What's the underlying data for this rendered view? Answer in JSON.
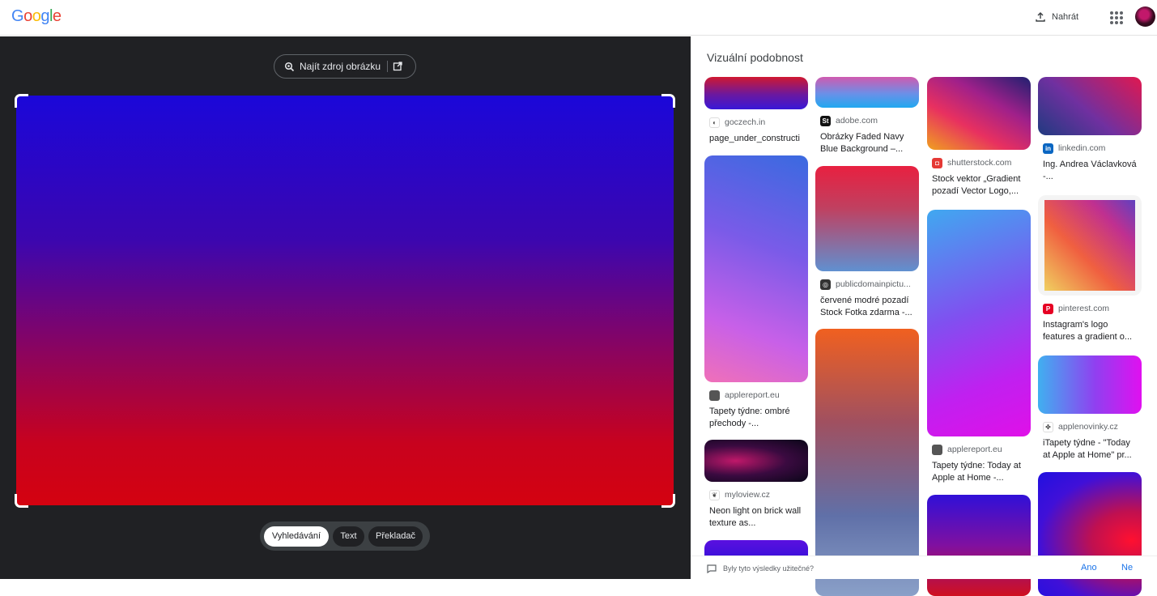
{
  "header": {
    "logo_letters": [
      {
        "ch": "G",
        "color": "#4285f4"
      },
      {
        "ch": "o",
        "color": "#ea4335"
      },
      {
        "ch": "o",
        "color": "#fbbc05"
      },
      {
        "ch": "g",
        "color": "#4285f4"
      },
      {
        "ch": "l",
        "color": "#34a853"
      },
      {
        "ch": "e",
        "color": "#ea4335"
      }
    ],
    "upload_label": "Nahrát"
  },
  "left_pane": {
    "find_source_label": "Najít zdroj obrázku",
    "modes": [
      {
        "label": "Vyhledávání",
        "active": true
      },
      {
        "label": "Text",
        "active": false
      },
      {
        "label": "Překladač",
        "active": false
      }
    ]
  },
  "results": {
    "title": "Vizuální podobnost",
    "columns": [
      [
        {
          "site": "goczech.in",
          "title": "page_under_constructi",
          "favicon": "#ffffff",
          "fav_glyph": "◐"
        },
        {
          "site": "applereport.eu",
          "title": "Tapety týdne: ombré přechody -...",
          "favicon": "#555555",
          "fav_glyph": ""
        },
        {
          "site": "myloview.cz",
          "title": "Neon light on brick wall texture as...",
          "favicon": "#ffffff",
          "fav_glyph": "❦"
        },
        {
          "site": "",
          "title": "",
          "favicon": "#ffffff",
          "fav_glyph": ""
        }
      ],
      [
        {
          "site": "adobe.com",
          "title": "Obrázky Faded Navy Blue Background –...",
          "favicon": "#111111",
          "fav_glyph": "St"
        },
        {
          "site": "publicdomainpictu...",
          "title": "červené modré pozadí Stock Fotka zdarma -...",
          "favicon": "#333333",
          "fav_glyph": "◎"
        },
        {
          "site": "",
          "title": "",
          "favicon": "#ffffff",
          "fav_glyph": ""
        }
      ],
      [
        {
          "site": "shutterstock.com",
          "title": "Stock vektor „Gradient pozadí Vector Logo,...",
          "favicon": "#e53935",
          "fav_glyph": "◘"
        },
        {
          "site": "applereport.eu",
          "title": "Tapety týdne: Today at Apple at Home -...",
          "favicon": "#555555",
          "fav_glyph": ""
        },
        {
          "site": "",
          "title": "",
          "favicon": "#ffffff",
          "fav_glyph": ""
        }
      ],
      [
        {
          "site": "linkedin.com",
          "title": "Ing. Andrea Václavková -...",
          "favicon": "#0a66c2",
          "fav_glyph": "in"
        },
        {
          "site": "pinterest.com",
          "title": "Instagram's logo features a gradient o...",
          "favicon": "#e60023",
          "fav_glyph": "P"
        },
        {
          "site": "applenovinky.cz",
          "title": "iTapety týdne - \"Today at Apple at Home\" pr...",
          "favicon": "#ffffff",
          "fav_glyph": "✤"
        },
        {
          "site": "",
          "title": "",
          "favicon": "#ffffff",
          "fav_glyph": ""
        }
      ]
    ],
    "feedback_question": "Byly tyto výsledky užitečné?",
    "feedback_yes": "Ano",
    "feedback_no": "Ne"
  }
}
